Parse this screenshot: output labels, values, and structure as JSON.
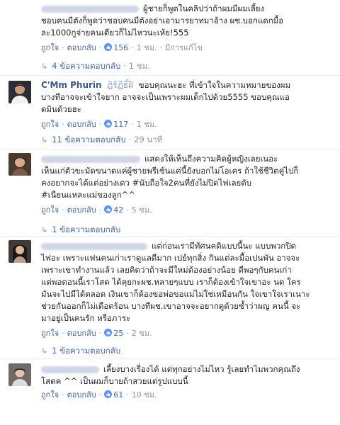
{
  "comments": [
    {
      "author": "",
      "text_lines": [
        "ผู้ชายก็พูดในคลิปว่าถ้าผมมีผมเลี้ยง",
        "ชอบคนมีตังก็พูดว่าชอบคนมีตังอย่าเอามารยาทมาอ้าง ผช.บอกแดกมื้อ",
        "ละ1000กูจ่ายคนเดียวก็ไม่ไหวนะเห้ย!555"
      ],
      "like": "ถูกใจ",
      "reply": "ตอบกลับ",
      "likes": "156",
      "time": "1 ชม.",
      "edited": "มีการแก้ไข",
      "replies_label": "4 ข้อความตอบกลับ",
      "replies_time": "1 ชม."
    },
    {
      "author": "C'Mm Phurin",
      "flair": "ฏิร้ฏิธิ์ฝิ",
      "text_lines": [
        "ขอบคุณนะฮะ ที่เข้าใจในความหมายของผม",
        "บางทีอาจจะเข้าใจยาก อาจจะเป็นเพราะผมเด็กไปด้วย5555 ขอบคุณแอ",
        "ดมินด้วยฮะ"
      ],
      "like": "ถูกใจ",
      "reply": "ตอบกลับ",
      "likes": "117",
      "time": "1 ชม.",
      "replies_label": "11 ข้อความตอบกลับ",
      "replies_time": "29 นาที"
    },
    {
      "author": "",
      "text_lines": [
        "แสดงให้เห็นถึงความคิดผู้หญิงเลยเนอะ",
        "เห็นแก่ตัวขะมัดขนาดแค่ผู้ชายพรีเซ้นแค่นี้ยังบอกไม่โอเคร ถ้าใช้ชีวิตคู่ไปก็",
        "คงอยากจะได้แต่อย่างเดว #นับถือใจ2คนที่ยังไม่ปิดไฟเลยดับ",
        "#เนียนแหละแม่ของลูก^^"
      ],
      "like": "ถูกใจ",
      "reply": "ตอบกลับ",
      "likes": "42",
      "time": "5 ชม.",
      "replies_label": "1 ข้อความตอบกลับ"
    },
    {
      "author": "",
      "text_lines": [
        "แต่ก่อนเรามีทัศนคติแบบนี้นะ แบบพวกปิด",
        "ไฟอะ เพราะแฟนคนเก่าเราดูแลดีมาก เปย์ทุกสิ่ง กินแต่ละมื้อเปนพัน อาจจะ",
        "เพราะเขาทำงานแล้ว เลยคิดว่าถ้าจะมีใหม่ต้องอย่างน้อย ดีพอๆกับคนเก่า",
        "แต่พอตอนนี้เราโสด ได้คุยกะผช.หลายๆแบบ เราก็ต้องเข้าใจเขาอะ นด ใคร",
        "มันจะไปมีได้ตลอด เงินเขาก็ต้องขอพ่อขอแม่ไม่ใช่เหมือนกัน ใจเขาใจเราเนาะ",
        "ช่วยกันออกก็ไม่เดือดร้อน บางทีผช.เขาอาจจะอยากดูด้วยซ้ำว่าผญ คนนี้ จะ",
        "มาอยู่เป็นคนรัก หรือภาระ"
      ],
      "like": "ถูกใจ",
      "reply": "ตอบกลับ",
      "likes": "25",
      "time": "2 ชม.",
      "replies_label": "1 ข้อความตอบกลับ"
    },
    {
      "author": "",
      "text_lines": [
        "เลี้ยงบางเรื่องได้ แต่ทุกอย่างไม่ไหว รู้เลยทำไมพวกคุณถึง",
        "โสดค ^^ เป็นผมก็บายถ้าสวยแต่รูปแบบนี้"
      ],
      "like": "ถูกใจ",
      "reply": "ตอบกลับ",
      "likes": "61",
      "time": "10 ชม."
    }
  ],
  "colors": {
    "link": "#4267b2",
    "name": "#365899",
    "meta": "#90949c"
  }
}
